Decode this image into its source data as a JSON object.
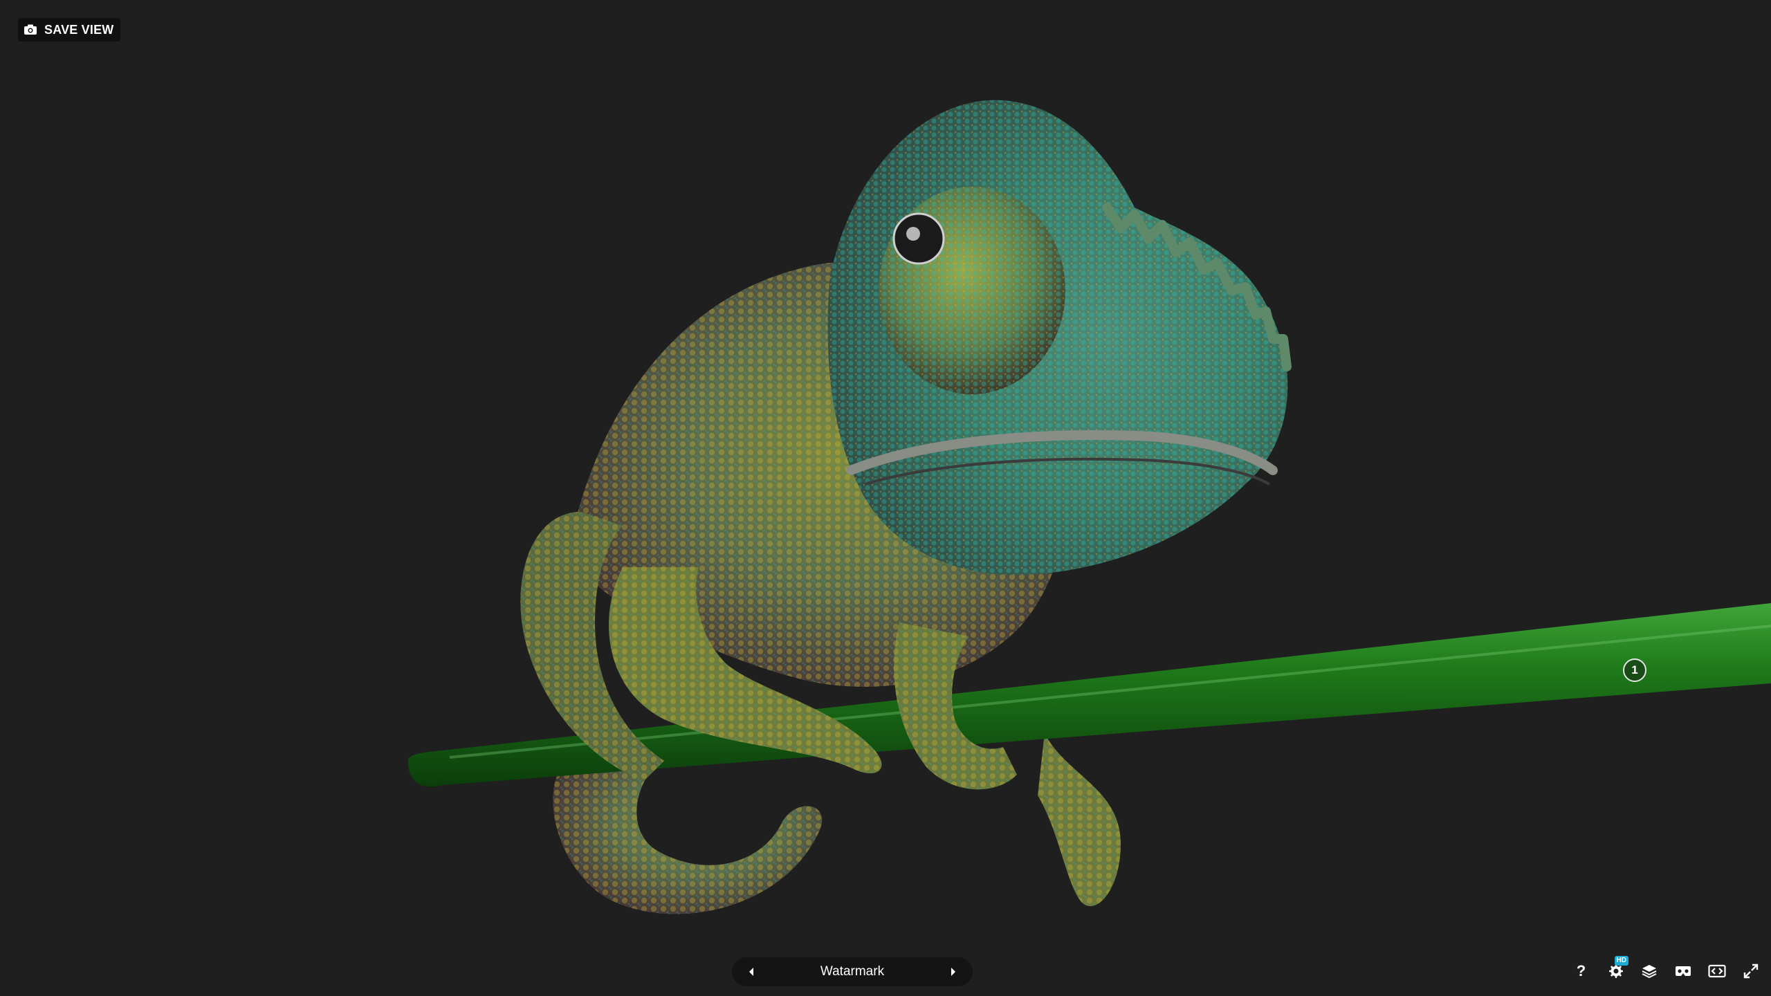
{
  "toolbar_top": {
    "save_view_label": "SAVE VIEW"
  },
  "hotspot": {
    "number": "1"
  },
  "annotation_nav": {
    "label": "Watarmark"
  },
  "toolbar_bottom": {
    "help_label": "?",
    "hd_badge": "HD",
    "icons": [
      "help-icon",
      "settings-icon",
      "layers-icon",
      "vr-icon",
      "embed-icon",
      "fullscreen-icon"
    ]
  },
  "colors": {
    "background": "#1f1f1f",
    "branch": "#1f7a1a",
    "accent": "#1caad9"
  }
}
